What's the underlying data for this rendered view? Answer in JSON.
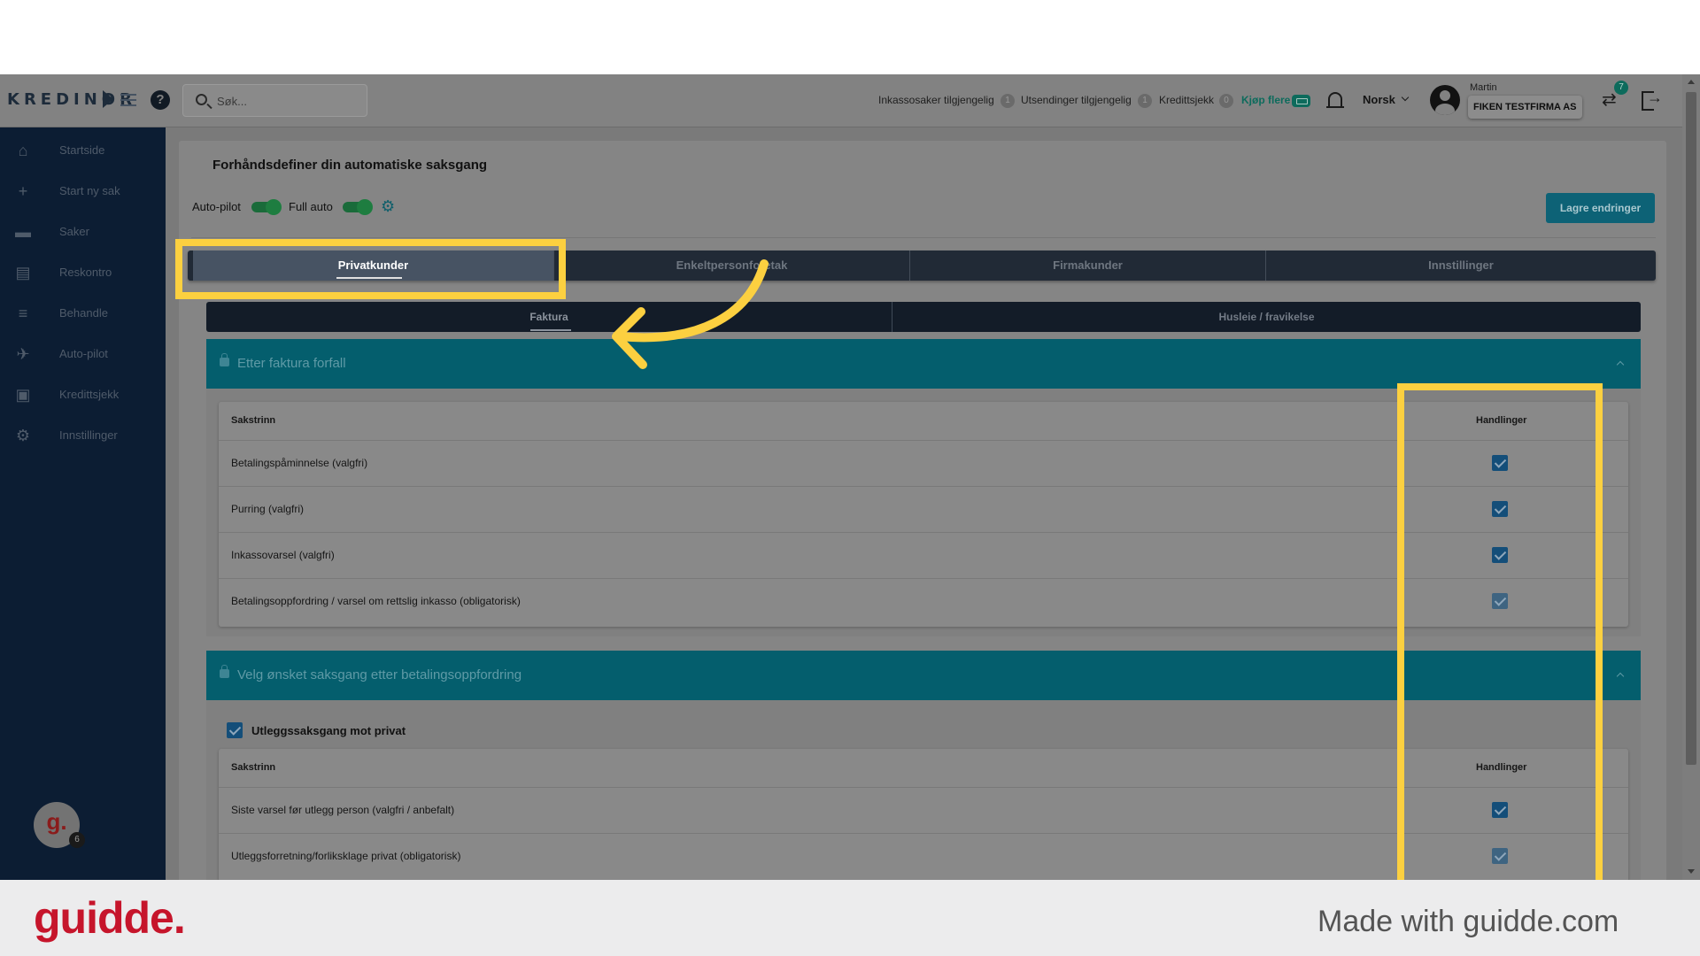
{
  "app": {
    "logo": "KREDINOR"
  },
  "search": {
    "placeholder": "Søk..."
  },
  "header": {
    "quotas": [
      {
        "label": "Inkassosaker tilgjengelig",
        "count": "1"
      },
      {
        "label": "Utsendinger tilgjengelig",
        "count": "1"
      },
      {
        "label": "Kredittsjekk",
        "count": "0"
      }
    ],
    "buy_more": "Kjøp flere",
    "language": "Norsk",
    "user_name": "Martin",
    "company": "FIKEN TESTFIRMA AS",
    "notification_count": "7"
  },
  "sidebar": {
    "items": [
      {
        "label": "Startside",
        "icon": "home-icon"
      },
      {
        "label": "Start ny sak",
        "icon": "plus-icon"
      },
      {
        "label": "Saker",
        "icon": "briefcase-icon"
      },
      {
        "label": "Reskontro",
        "icon": "document-icon"
      },
      {
        "label": "Behandle",
        "icon": "checklist-icon"
      },
      {
        "label": "Auto-pilot",
        "icon": "airplane-icon"
      },
      {
        "label": "Kredittsjekk",
        "icon": "credit-check-icon"
      },
      {
        "label": "Innstillinger",
        "icon": "gear-icon"
      }
    ],
    "guidde_avatar": "g.",
    "guidde_count": "6"
  },
  "page": {
    "title": "Forhåndsdefiner din automatiske saksgang",
    "autopilot_label": "Auto-pilot",
    "fullauto_label": "Full auto",
    "autopilot_on": true,
    "fullauto_on": true,
    "save_label": "Lagre endringer",
    "tabs": [
      "Privatkunder",
      "Enkeltpersonforetak",
      "Firmakunder",
      "Innstillinger"
    ],
    "active_tab": "Privatkunder",
    "subtabs": [
      "Faktura",
      "Husleie / fravikelse"
    ],
    "active_subtab": "Faktura"
  },
  "panel1": {
    "title": "Etter faktura forfall",
    "col_step": "Sakstrinn",
    "col_actions": "Handlinger",
    "rows": [
      {
        "label": "Betalingspåminnelse (valgfri)",
        "checked": true
      },
      {
        "label": "Purring (valgfri)",
        "checked": true
      },
      {
        "label": "Inkassovarsel (valgfri)",
        "checked": true
      },
      {
        "label": "Betalingsoppfordring / varsel om rettslig inkasso (obligatorisk)",
        "checked": true
      }
    ]
  },
  "panel2": {
    "title": "Velg ønsket saksgang etter betalingsoppfordring",
    "option_label": "Utleggssaksgang mot privat",
    "option_checked": true,
    "col_step": "Sakstrinn",
    "col_actions": "Handlinger",
    "rows": [
      {
        "label": "Siste varsel før utlegg person (valgfri / anbefalt)",
        "checked": true
      },
      {
        "label": "Utleggsforretning/forliksklage privat (obligatorisk)",
        "checked": true
      }
    ]
  },
  "footer": {
    "brand": "guidde.",
    "made_with": "Made with guidde.com"
  },
  "colors": {
    "highlight": "#fcd040",
    "brand_red": "#c6152b",
    "teal": "#045e6d"
  }
}
